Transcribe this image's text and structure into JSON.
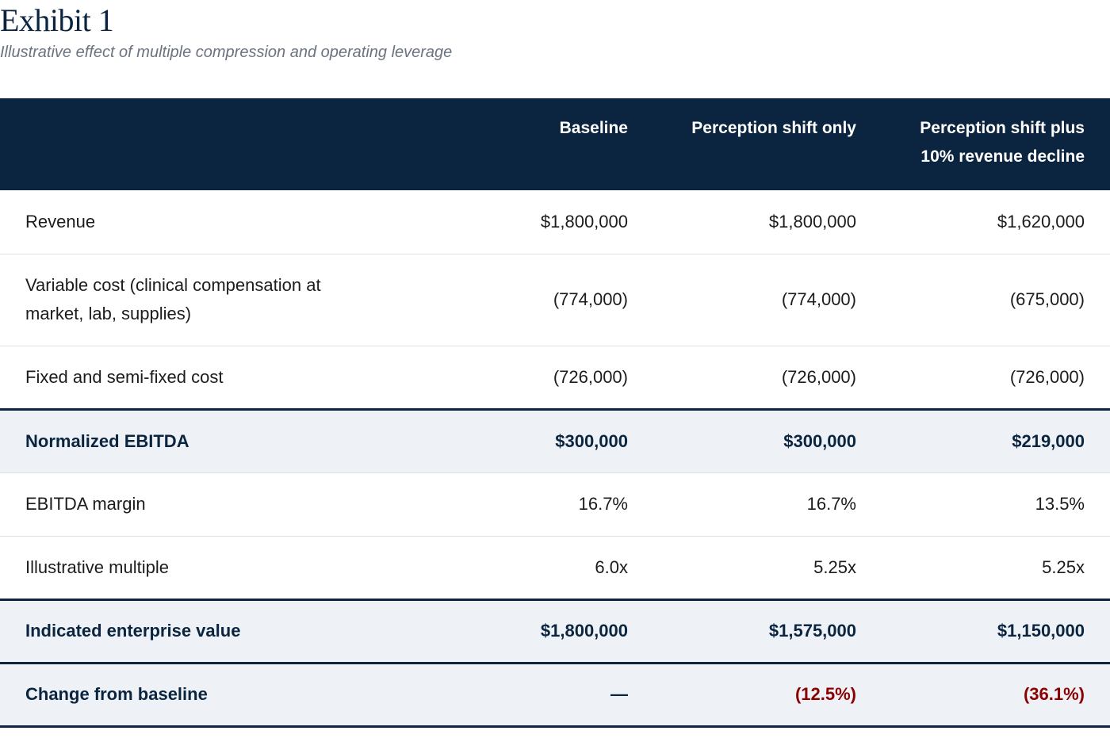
{
  "exhibit": {
    "title": "Exhibit 1",
    "subtitle": "Illustrative effect of multiple compression and operating leverage"
  },
  "table": {
    "columns": [
      {
        "line1": "Baseline",
        "line2": ""
      },
      {
        "line1": "Perception shift only",
        "line2": ""
      },
      {
        "line1": "Perception shift plus",
        "line2": "10% revenue decline"
      }
    ],
    "rows": [
      {
        "label": [
          "Revenue"
        ],
        "values": [
          "$1,800,000",
          "$1,800,000",
          "$1,620,000"
        ]
      },
      {
        "label": [
          "Variable cost (clinical compensation at",
          "market, lab, supplies)"
        ],
        "values": [
          "(774,000)",
          "(774,000)",
          "(675,000)"
        ]
      },
      {
        "label": [
          "Fixed and semi-fixed cost"
        ],
        "values": [
          "(726,000)",
          "(726,000)",
          "(726,000)"
        ]
      },
      {
        "label": [
          "Normalized EBITDA"
        ],
        "values": [
          "$300,000",
          "$300,000",
          "$219,000"
        ]
      },
      {
        "label": [
          "EBITDA margin"
        ],
        "values": [
          "16.7%",
          "16.7%",
          "13.5%"
        ]
      },
      {
        "label": [
          "Illustrative multiple"
        ],
        "values": [
          "6.0x",
          "5.25x",
          "5.25x"
        ]
      },
      {
        "label": [
          "Indicated enterprise value"
        ],
        "values": [
          "$1,800,000",
          "$1,575,000",
          "$1,150,000"
        ]
      },
      {
        "label": [
          "Change from baseline"
        ],
        "values": [
          "—",
          "(12.5%)",
          "(36.1%)"
        ]
      }
    ]
  },
  "colors": {
    "header_bg": "#0b2540",
    "emphasis_bg": "#eef2f6",
    "negative": "#8b0000"
  }
}
